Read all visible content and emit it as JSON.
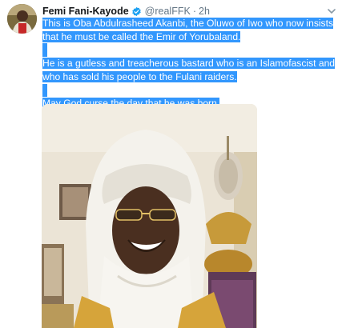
{
  "tweet": {
    "author_name": "Femi Fani-Kayode",
    "handle": "@realFFK",
    "separator": "·",
    "time": "2h",
    "paragraphs": [
      "This is Oba Abdulrasheed Akanbi, the Oluwo of Iwo who now insists that he must be called the Emir of Yorubaland.",
      "He is a gutless and treacherous bastard who is an Islamofascist and who has sold his people to the Fulani raiders.",
      "May God curse the day that he was born."
    ]
  },
  "colors": {
    "selection": "#3297fd",
    "verified": "#1da1f2",
    "secondary_text": "#657786"
  },
  "icons": {
    "verified": "verified-badge-icon",
    "menu": "chevron-down-icon"
  }
}
